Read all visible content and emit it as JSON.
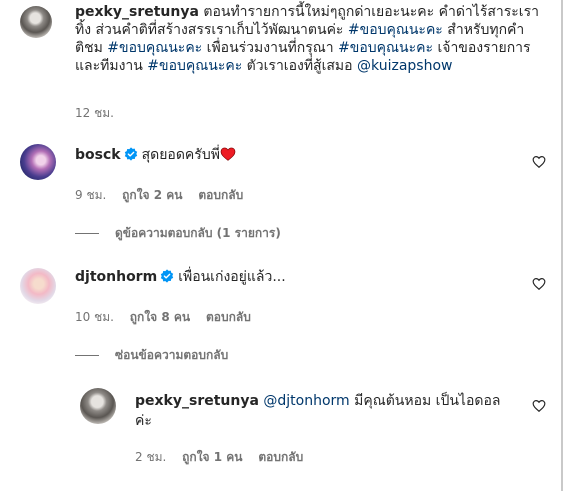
{
  "post_caption": {
    "username": "pexky_sretunya",
    "line1": "ตอนทำรายการนี้ใหม่ๆถูกด่าเยอะนะคะ คำด่าไร้สาระเรา",
    "line2": "ทิ้ง ส่วนคำติที่สร้างสรรเราเก็บไว้พัฒนาตนค่ะ ",
    "tag1": "#ขอบคุณนะคะ",
    "line2b": " สำหรับทุกคำ",
    "line3a": "ติชม ",
    "tag2": "#ขอบคุณนะคะ",
    "line3b": " เพื่อนร่วมงานที่กรุณา ",
    "tag3": "#ขอบคุณนะคะ",
    "line3c": " เจ้าของรายการ",
    "line4a": "และทีมงาน ",
    "tag4": "#ขอบคุณนะคะ",
    "line4b": " ตัวเราเองที่สู้เสมอ ",
    "mention": "@kuizapshow",
    "time": "12 ชม."
  },
  "comments": [
    {
      "username": "bosck",
      "verified": true,
      "text": "สุดยอดครับพี่",
      "emoji": "red-heart",
      "time": "9 ชม.",
      "likes": "ถูกใจ 2 คน",
      "reply": "ตอบกลับ",
      "replies_toggle": "ดูข้อความตอบกลับ (1 รายการ)"
    },
    {
      "username": "djtonhorm",
      "verified": true,
      "text": "เพื่อนเก่งอยู่แล้ว...",
      "time": "10 ชม.",
      "likes": "ถูกใจ 8 คน",
      "reply": "ตอบกลับ",
      "replies_toggle": "ซ่อนข้อความตอบกลับ"
    }
  ],
  "reply": {
    "username": "pexky_sretunya",
    "mention": "@djtonhorm",
    "text_line1": " มีคุณต้นหอม เป็นไอดอล",
    "text_line2": "ค่ะ",
    "time": "2 ชม.",
    "likes": "ถูกใจ 1 คน",
    "reply": "ตอบกลับ"
  },
  "colors": {
    "link": "#00376b",
    "muted": "#737373",
    "verified": "#0095f6",
    "heart": "#ed1c24"
  }
}
